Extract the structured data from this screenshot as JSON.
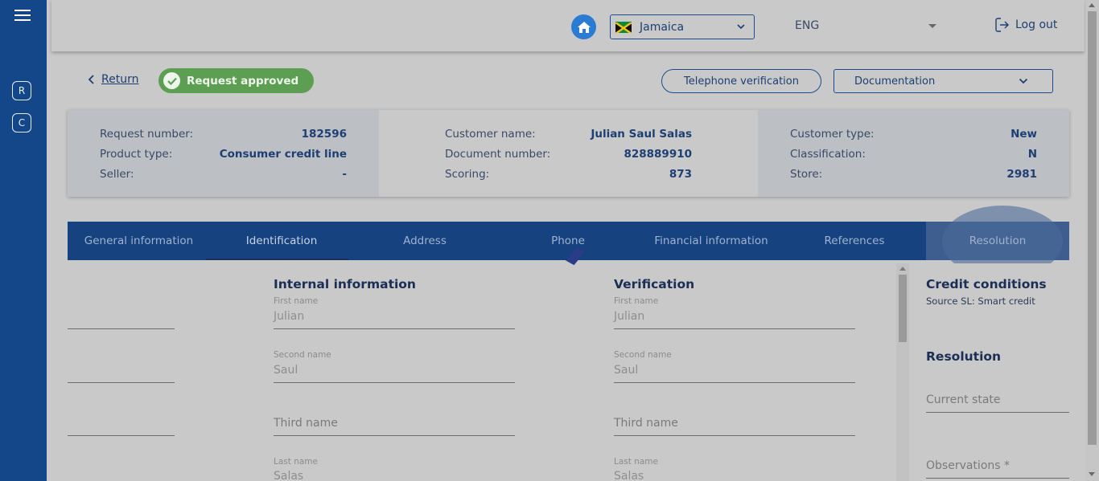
{
  "header": {
    "country": "Jamaica",
    "language": "ENG",
    "logout_label": "Log out"
  },
  "sidebar": {
    "items": [
      {
        "letter": "R"
      },
      {
        "letter": "C"
      }
    ]
  },
  "actions": {
    "return_label": "Return",
    "status_label": "Request approved",
    "telephone_label": "Telephone verification",
    "documentation_label": "Documentation"
  },
  "info": {
    "col1": [
      {
        "label": "Request number:",
        "value": "182596"
      },
      {
        "label": "Product type:",
        "value": "Consumer credit line"
      },
      {
        "label": "Seller:",
        "value": "-"
      }
    ],
    "col2": [
      {
        "label": "Customer name:",
        "value": "Julian Saul Salas"
      },
      {
        "label": "Document number:",
        "value": "828889910"
      },
      {
        "label": "Scoring:",
        "value": "873"
      }
    ],
    "col3": [
      {
        "label": "Customer type:",
        "value": "New"
      },
      {
        "label": "Classification:",
        "value": "N"
      },
      {
        "label": "Store:",
        "value": "2981"
      }
    ]
  },
  "tabs": [
    {
      "label": "General information"
    },
    {
      "label": "Identification"
    },
    {
      "label": "Address"
    },
    {
      "label": "Phone"
    },
    {
      "label": "Financial information"
    },
    {
      "label": "References"
    },
    {
      "label": "Resolution"
    }
  ],
  "internal": {
    "title": "Internal information",
    "first_name_label": "First name",
    "first_name": "Julian",
    "second_name_label": "Second name",
    "second_name": "Saul",
    "third_name_placeholder": "Third name",
    "last_name_label": "Last name",
    "last_name": "Salas"
  },
  "verification": {
    "title": "Verification",
    "first_name_label": "First name",
    "first_name": "Julian",
    "second_name_label": "Second name",
    "second_name": "Saul",
    "third_name_placeholder": "Third name",
    "last_name_label": "Last name",
    "last_name": "Salas"
  },
  "credit": {
    "title": "Credit conditions",
    "source": "Source SL: Smart credit",
    "resolution_title": "Resolution",
    "current_state_placeholder": "Current state",
    "observations_placeholder": "Observations *"
  },
  "colors": {
    "sidebar": "#14478a",
    "tabs": "#16427f",
    "approved": "#5d9f52",
    "accent": "#2a7bd1"
  }
}
